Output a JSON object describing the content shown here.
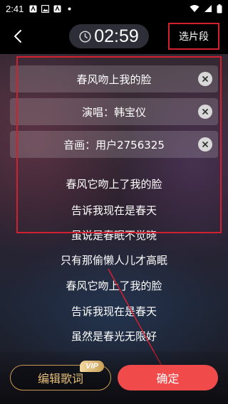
{
  "status_bar": {
    "time": "2:41",
    "icons": [
      "notification-a-icon",
      "image-icon",
      "notification-a-icon",
      "dot-icon",
      "wifi-icon",
      "signal-icon",
      "battery-icon"
    ]
  },
  "header": {
    "timer": "02:59",
    "select_segment_label": "选片段"
  },
  "info_rows": {
    "title": "春风吻上我的脸",
    "singer": "演唱：韩宝仪",
    "image": "音画：用户2756325"
  },
  "lyrics": [
    "春风它吻上了我的脸",
    "告诉我现在是春天",
    "虽说是春眠不觉晓",
    "只有那偷懒人儿才高眠",
    "春风它吻上了我的脸",
    "告诉我现在是春天",
    "虽然是春光无限好"
  ],
  "bottom": {
    "edit_lyrics_label": "编辑歌词",
    "vip_badge": "VIP",
    "confirm_label": "确定"
  },
  "colors": {
    "accent_red": "#f04a4a",
    "annotation_red": "#d32030",
    "gold": "#c99a4e"
  }
}
